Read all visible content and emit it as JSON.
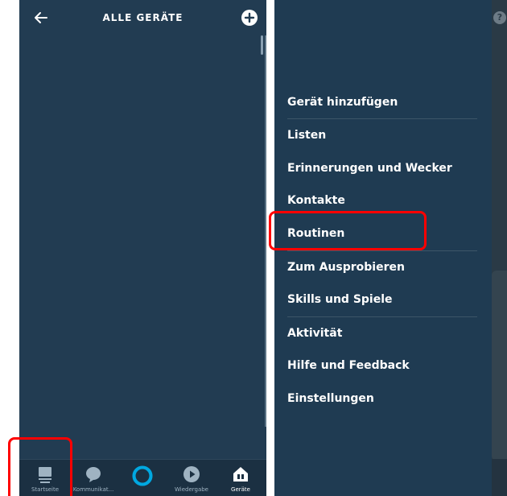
{
  "left_screen": {
    "header": {
      "title": "ALLE GERÄTE"
    },
    "bottom_nav": [
      {
        "label": "Startseite",
        "icon": "home-icon"
      },
      {
        "label": "Kommunikat...",
        "icon": "chat-bubble-icon"
      },
      {
        "label": "",
        "icon": "alexa-ring-icon"
      },
      {
        "label": "Wiedergabe",
        "icon": "play-icon"
      },
      {
        "label": "Geräte",
        "icon": "devices-icon"
      }
    ]
  },
  "right_screen": {
    "menu": [
      "Gerät hinzufügen",
      "Listen",
      "Erinnerungen und Wecker",
      "Kontakte",
      "Routinen",
      "Zum Ausprobieren",
      "Skills und Spiele",
      "Aktivität",
      "Hilfe und Feedback",
      "Einstellungen"
    ],
    "help_glyph": "?"
  },
  "colors": {
    "panel_bg": "#223c52",
    "drawer_bg": "#1f3b52",
    "alexa_accent": "#00a8e1",
    "highlight": "#ff0000"
  }
}
